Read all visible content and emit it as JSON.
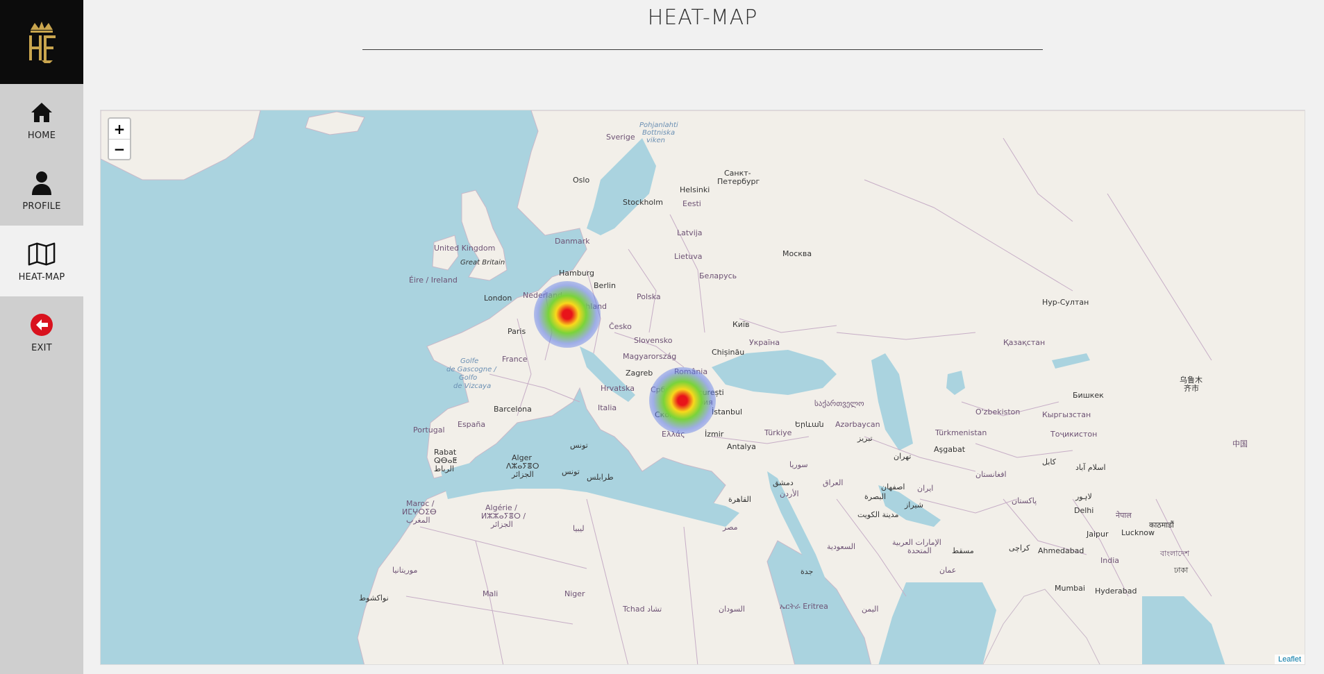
{
  "brand": {
    "logo_text": "HF"
  },
  "sidebar": {
    "items": [
      {
        "label": "HOME",
        "icon": "home-icon"
      },
      {
        "label": "PROFILE",
        "icon": "user-icon"
      },
      {
        "label": "HEAT-MAP",
        "icon": "map-icon",
        "active": true
      },
      {
        "label": "EXIT",
        "icon": "exit-icon"
      }
    ]
  },
  "header": {
    "title": "HEAT-MAP"
  },
  "map": {
    "zoom_in": "+",
    "zoom_out": "−",
    "attribution": "Leaflet",
    "labels": {
      "sverige": "Sverige",
      "pohjanlahti": "Pohjanlahti",
      "bottniska": "Bottniska",
      "viken": "viken",
      "oslo": "Oslo",
      "helsinki": "Helsinki",
      "spb1": "Санкт-",
      "spb2": "Петербург",
      "stockholm": "Stockholm",
      "eesti": "Eesti",
      "danmark": "Danmark",
      "latvija": "Latvija",
      "moskva": "Москва",
      "uk": "United Kingdom",
      "gb": "Great Britain",
      "lietuva": "Lietuva",
      "hamburg": "Hamburg",
      "eire": "Éire / Ireland",
      "belarus": "Беларусь",
      "berlin": "Berlin",
      "nederland": "Nederland",
      "london": "London",
      "polska": "Polska",
      "deutschland": "Deutschland",
      "nur_sultan": "Нур-Султан",
      "cesko": "Česko",
      "kyiv": "Київ",
      "paris": "Paris",
      "slovensko": "Slovensko",
      "ukraina": "Україна",
      "kazakhstan": "Қазақстан",
      "chisinau": "Chișinău",
      "france": "France",
      "magyarorszag": "Magyarország",
      "golfe1": "Golfe",
      "golfe2": "de Gascogne /",
      "golfe3": "Golfo",
      "golfe4": "de Vizcaya",
      "zagreb": "Zagreb",
      "romania": "România",
      "urumqi1": "乌鲁木",
      "urumqi2": "齐市",
      "hrvatska": "Hrvatska",
      "srbija": "Србија",
      "bucuresti": "București",
      "bishkek": "Бишкек",
      "bulgaria": "България",
      "barcelona": "Barcelona",
      "italia": "Italia",
      "georgia": "საქართველო",
      "uzbekistan": "O'zbekiston",
      "istanbul": "İstanbul",
      "kyrgyzstan": "Кыргызстан",
      "skopje": "Скопје",
      "portugal": "Portugal",
      "espana": "España",
      "azerbaycan": "Azərbaycan",
      "yerevan": "Երևան",
      "ellas": "Ελλάς",
      "izmir": "İzmir",
      "turkiye": "Türkiye",
      "turkmenistan": "Türkmenistan",
      "tajikistan": "Тоҷикистон",
      "tabriz": "تبریز",
      "tunis": "تونس",
      "ashgabat": "Aşgabat",
      "china": "中国",
      "rabat": "Rabat",
      "alger": "Alger",
      "antalya": "Antalya",
      "tehran": "تهران",
      "rabat2": "ⵕⴱⴰⵟ",
      "alger2": "ⴷⵣⴰⵢⴻⵔ",
      "rabat3": "الرباط",
      "alger3": "الجزائر",
      "tunis2": "تونس",
      "syria": "سوريا",
      "kabul": "کابل",
      "islamabad": "اسلام آباد",
      "tarabulus": "طرابلس",
      "dimashq": "دمشق",
      "iraq": "العراق",
      "isfahan": "اصفهان",
      "afghanistan": "افغانستان",
      "iran": "ایران",
      "maroc": "Maroc /",
      "maroc2": "ⵍⵎⵖⵔⵉⴱ",
      "maroc3": "المغرب",
      "algerie": "Algérie /",
      "algerie2": "ⵍⵣⵣⴰⵢⴻⵔ /",
      "algerie3": "الجزائر",
      "lahore": "لاہور",
      "pakistan": "پاکستان",
      "urdun": "الأردن",
      "basra": "البصرة",
      "shiraz": "شیراز",
      "qahira": "القاهرة",
      "delhi": "Delhi",
      "kuwait": "مدينة الكويت",
      "nepal": "नेपाल",
      "kathmandu": "काठमाडौं",
      "libya": "ليبيا",
      "misr": "مصر",
      "saudi": "السعودية",
      "jaipur": "Jaipur",
      "lucknow": "Lucknow",
      "uae": "الإمارات العربية",
      "uae2": "المتحدة",
      "karachi": "کراچی",
      "ahmedabad": "Ahmedabad",
      "bangladesh": "বাংলাদেশ",
      "muscat": "مسقط",
      "mauritania": "موريتانيا",
      "india": "India",
      "jiddah": "جدة",
      "oman": "عمان",
      "dhaka": "ঢাকা",
      "mumbai": "Mumbai",
      "hyderabad": "Hyderabad",
      "mali": "Mali",
      "niger": "Niger",
      "nouakchott": "نواكشوط",
      "tchad": "Tchad تشاد",
      "sudan": "السودان",
      "eritrea": "ኤርትራ Eritrea",
      "yemen": "اليمن"
    }
  },
  "heat_points": [
    {
      "name": "Luxembourg area",
      "intensity": 1.0
    },
    {
      "name": "Skopje area",
      "intensity": 1.0
    }
  ]
}
